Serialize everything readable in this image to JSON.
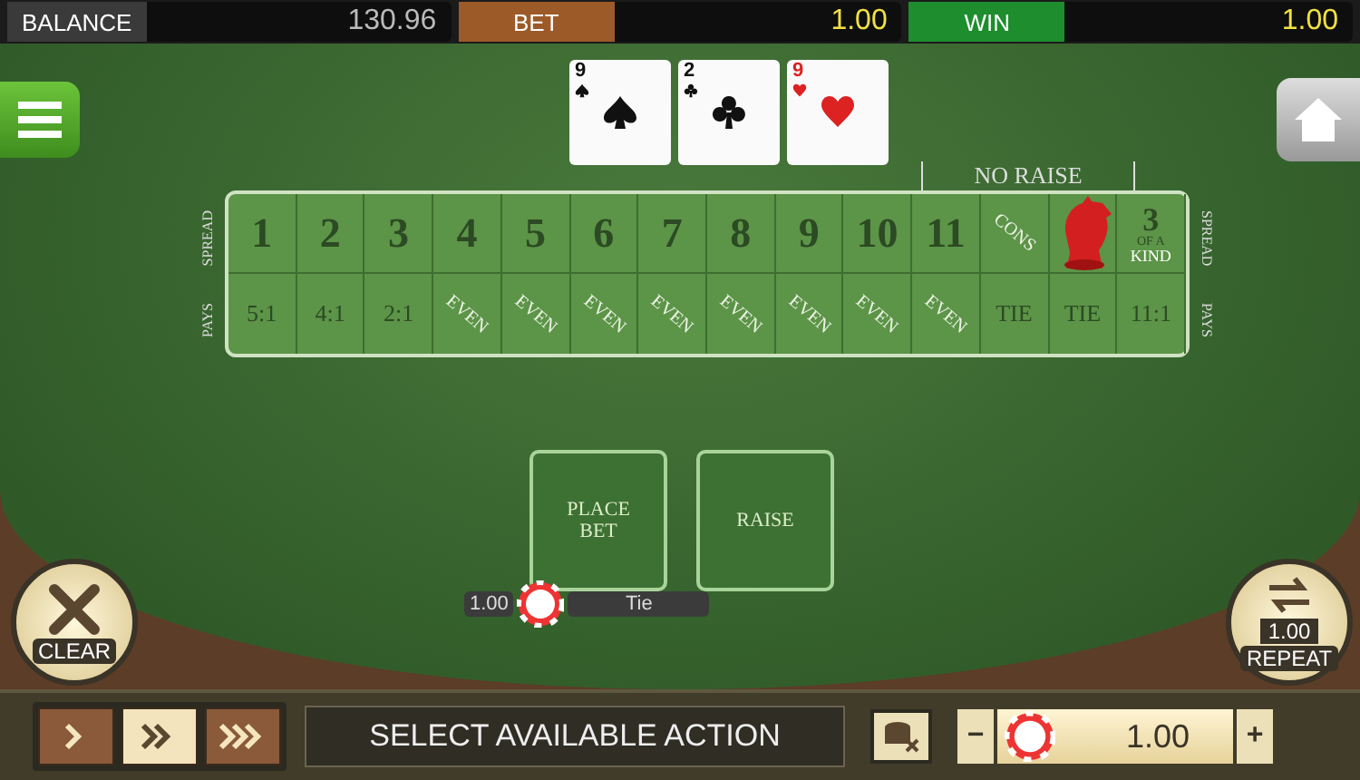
{
  "top_bar": [
    {
      "label": "BALANCE",
      "value": "130.96",
      "kind": "balance"
    },
    {
      "label": "BET",
      "value": "1.00",
      "kind": "bet"
    },
    {
      "label": "WIN",
      "value": "1.00",
      "kind": "win"
    }
  ],
  "cards": [
    {
      "rank": "9",
      "kind": "spades"
    },
    {
      "rank": "2",
      "kind": "clubs"
    },
    {
      "rank": "9",
      "kind": "hearts"
    }
  ],
  "table": {
    "no_raise": "NO RAISE",
    "left_labels": [
      "SPREAD",
      "PAYS"
    ],
    "right_labels": [
      "SPREAD",
      "PAYS"
    ],
    "spread": [
      {
        "kind": "number",
        "lines": [
          "1"
        ]
      },
      {
        "kind": "number",
        "lines": [
          "2"
        ]
      },
      {
        "kind": "number",
        "lines": [
          "3"
        ]
      },
      {
        "kind": "number",
        "lines": [
          "4"
        ]
      },
      {
        "kind": "number",
        "lines": [
          "5"
        ]
      },
      {
        "kind": "number",
        "lines": [
          "6"
        ]
      },
      {
        "kind": "number",
        "lines": [
          "7"
        ]
      },
      {
        "kind": "number",
        "lines": [
          "8"
        ]
      },
      {
        "kind": "number",
        "lines": [
          "9"
        ]
      },
      {
        "kind": "number",
        "lines": [
          "10"
        ]
      },
      {
        "kind": "number",
        "lines": [
          "11"
        ]
      },
      {
        "kind": "diagonal",
        "lines": [
          "CONS"
        ]
      },
      {
        "kind": "piece"
      },
      {
        "kind": "stacked",
        "lines": [
          "3",
          "OF A",
          "KIND"
        ]
      }
    ],
    "pays": [
      {
        "kind": "plain",
        "label": "5:1"
      },
      {
        "kind": "plain",
        "label": "4:1"
      },
      {
        "kind": "plain",
        "label": "2:1"
      },
      {
        "kind": "diagonal",
        "label": "EVEN"
      },
      {
        "kind": "diagonal",
        "label": "EVEN"
      },
      {
        "kind": "diagonal",
        "label": "EVEN"
      },
      {
        "kind": "diagonal",
        "label": "EVEN"
      },
      {
        "kind": "diagonal",
        "label": "EVEN"
      },
      {
        "kind": "diagonal",
        "label": "EVEN"
      },
      {
        "kind": "diagonal",
        "label": "EVEN"
      },
      {
        "kind": "diagonal",
        "label": "EVEN"
      },
      {
        "kind": "plain",
        "label": "TIE"
      },
      {
        "kind": "plain",
        "label": "TIE"
      },
      {
        "kind": "plain",
        "label": "11:1"
      }
    ]
  },
  "bet_spots": [
    {
      "label": "PLACE BET"
    },
    {
      "label": "RAISE"
    }
  ],
  "placed_bet": {
    "amount": "1.00",
    "name": "Tie"
  },
  "clear": {
    "label": "CLEAR"
  },
  "repeat": {
    "label": "REPEAT",
    "amount": "1.00"
  },
  "speed": [
    {
      "kind": "single",
      "selected": false
    },
    {
      "kind": "double",
      "selected": true
    },
    {
      "kind": "triple",
      "selected": false
    }
  ],
  "status": "SELECT AVAILABLE ACTION",
  "chip_stepper": {
    "minus": "−",
    "value": "1.00",
    "plus": "+"
  }
}
